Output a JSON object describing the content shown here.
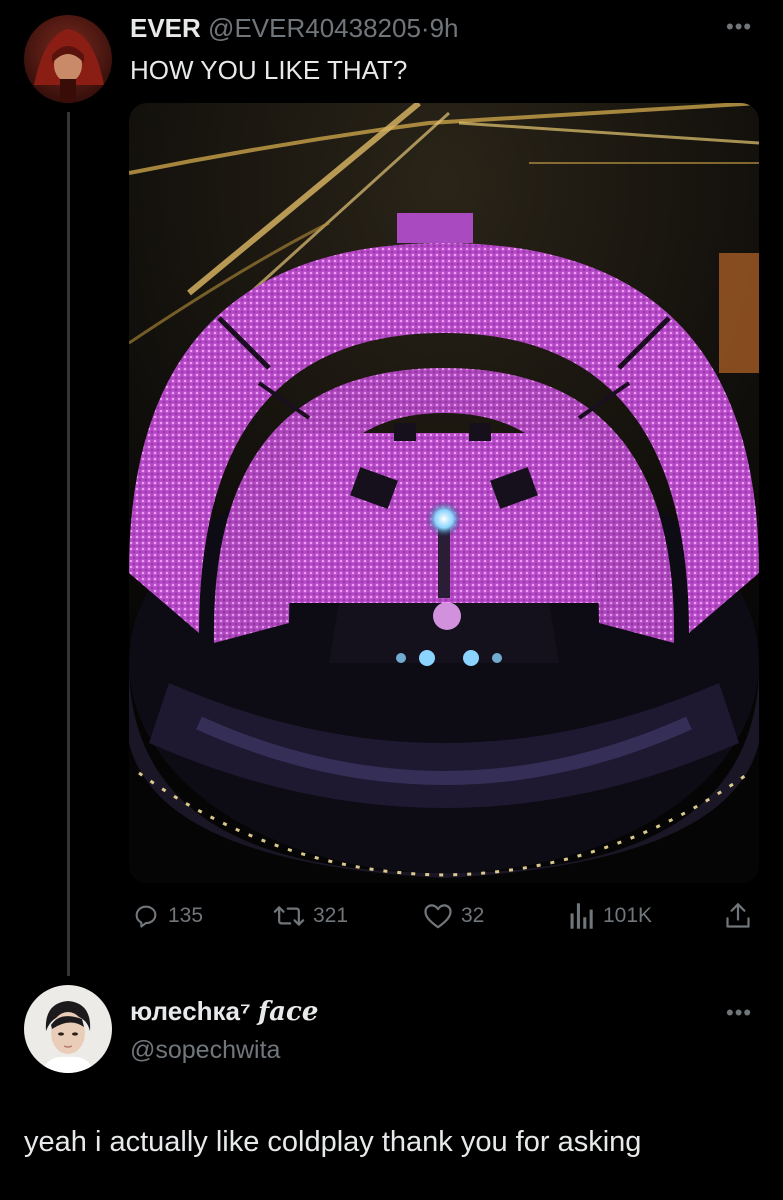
{
  "tweet": {
    "author_name": "EVER",
    "author_handle": "@EVER40438205",
    "time": "·9h",
    "text": "HOW YOU LIKE THAT?",
    "more_icon": "more-horizontal-icon",
    "image_description_icon": "stadium-photo",
    "actions": {
      "replies": "135",
      "retweets": "321",
      "likes": "32",
      "views": "101K"
    }
  },
  "reply": {
    "author_name": "юлеchка⁷",
    "author_name_styled": "face",
    "author_handle": "@sopechwita",
    "text": "yeah i actually like coldplay thank you for asking"
  },
  "colors": {
    "background": "#000000",
    "text_primary": "#e7e9ea",
    "text_secondary": "#71767b",
    "crowd_pink": "#c64fd8"
  }
}
